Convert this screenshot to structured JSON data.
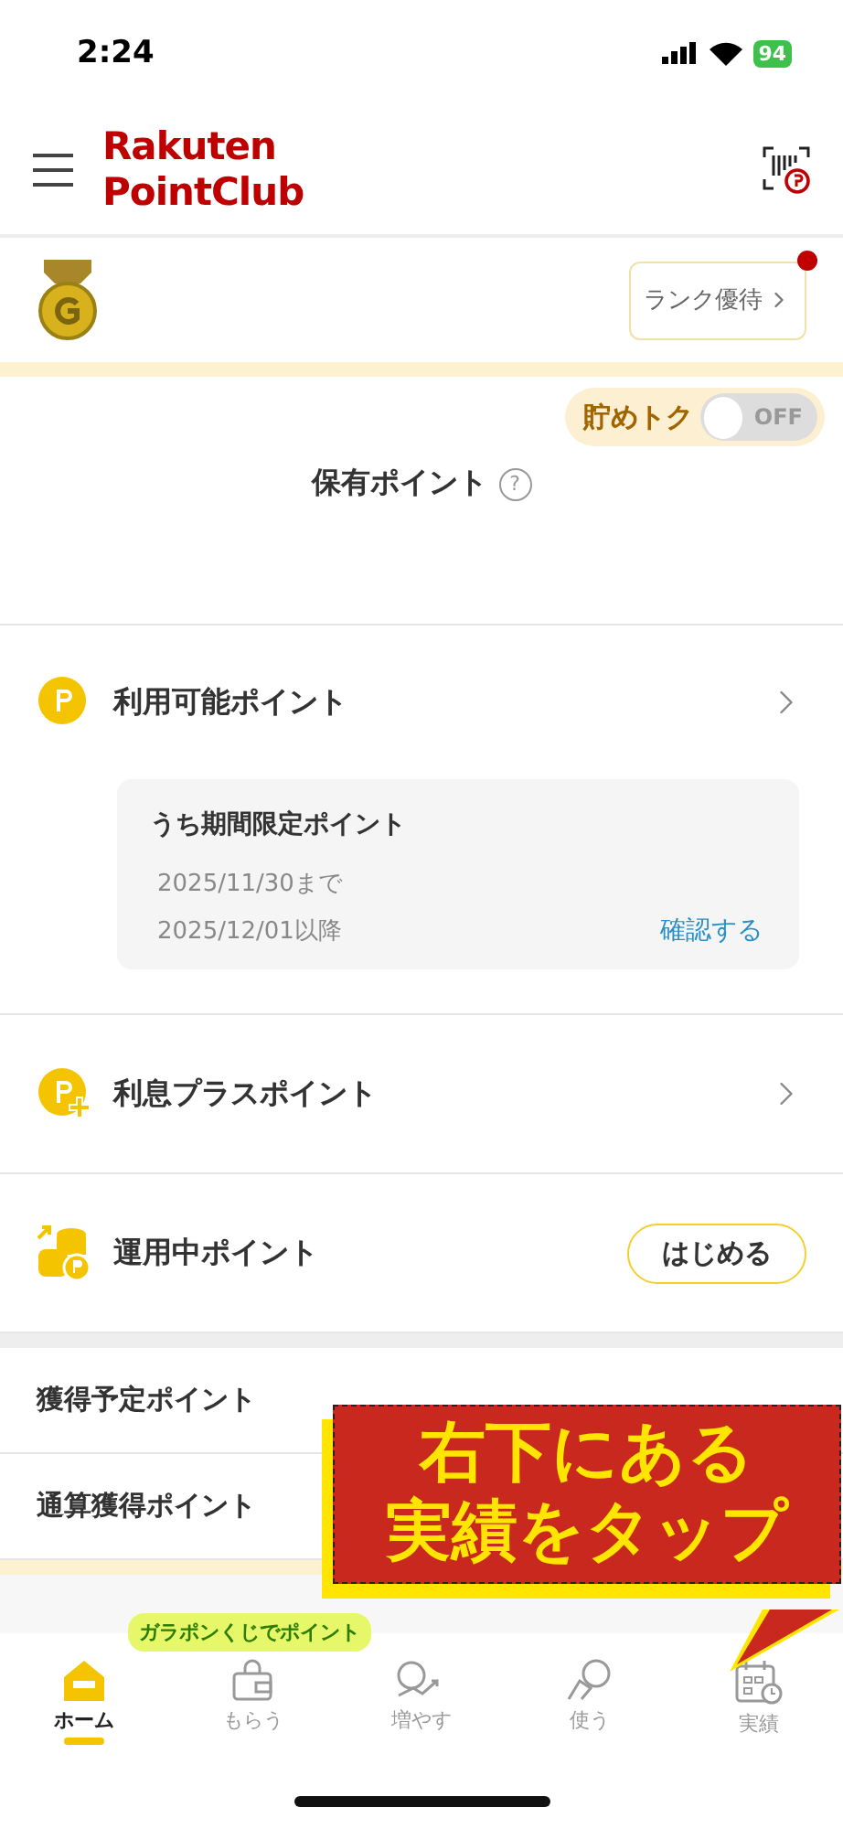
{
  "status_bar": {
    "time": "2:24",
    "battery": "94"
  },
  "header": {
    "logo_line_1": "Rakuten",
    "logo_line_2": "PointClub"
  },
  "rank": {
    "button": "ランク優待",
    "has_notification": true
  },
  "savings_toggle": {
    "label": "貯めトク",
    "state_text": "OFF",
    "on": false
  },
  "held_points": {
    "label": "保有ポイント",
    "help": "?"
  },
  "point_rows": [
    {
      "kind": "link",
      "label": "利用可能ポイント"
    },
    {
      "kind": "link",
      "label": "利息プラスポイント"
    },
    {
      "kind": "button",
      "label": "運用中ポイント",
      "button": "はじめる"
    }
  ],
  "limited_card": {
    "title": "うち期間限定ポイント",
    "lines": [
      {
        "text": "2025/11/30まで"
      },
      {
        "text": "2025/12/01以降",
        "link": "確認する"
      }
    ]
  },
  "summary_rows": [
    {
      "label": "獲得予定ポイント"
    },
    {
      "label": "通算獲得ポイント"
    }
  ],
  "tooltip": "ガラポンくじでポイント",
  "callout": {
    "lines": [
      "右下にある",
      "実績をタップ"
    ]
  },
  "nav": [
    {
      "label": "ホーム",
      "selected": true
    },
    {
      "label": "もらう",
      "selected": false
    },
    {
      "label": "増やす",
      "selected": false
    },
    {
      "label": "使う",
      "selected": false
    },
    {
      "label": "実績",
      "selected": false
    }
  ]
}
